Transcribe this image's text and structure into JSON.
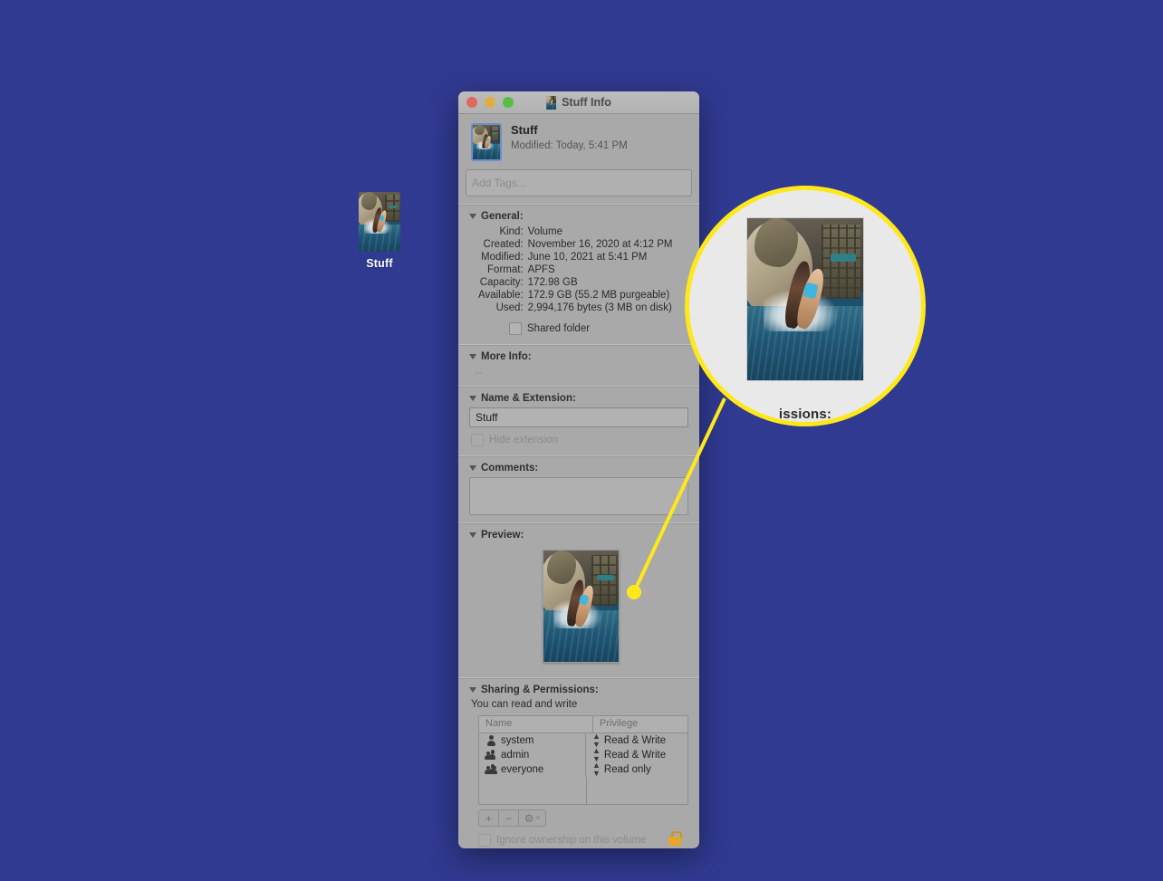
{
  "desktop": {
    "background_color": "#303a91",
    "icon": {
      "label": "Stuff",
      "name": "volume-icon"
    }
  },
  "window": {
    "title": "Stuff Info",
    "traffic_lights": {
      "close": "close-button",
      "minimize": "minimize-button",
      "zoom": "zoom-button",
      "red": "#e0695f",
      "yellow": "#dfae42",
      "green": "#57bd46"
    },
    "header": {
      "name": "Stuff",
      "modified": "Modified: Today, 5:41 PM"
    },
    "tags": {
      "placeholder": "Add Tags..."
    },
    "general": {
      "title": "General:",
      "rows": [
        {
          "key": "Kind:",
          "value": "Volume"
        },
        {
          "key": "Created:",
          "value": "November 16, 2020 at 4:12 PM"
        },
        {
          "key": "Modified:",
          "value": "June 10, 2021 at 5:41 PM"
        },
        {
          "key": "Format:",
          "value": "APFS"
        },
        {
          "key": "Capacity:",
          "value": "172.98 GB"
        },
        {
          "key": "Available:",
          "value": "172.9 GB (55.2 MB purgeable)"
        },
        {
          "key": "Used:",
          "value": "2,994,176 bytes (3 MB on disk)"
        }
      ],
      "shared_folder_label": "Shared folder",
      "shared_folder_checked": false
    },
    "more_info": {
      "title": "More Info:",
      "body": "--"
    },
    "name_extension": {
      "title": "Name & Extension:",
      "value": "Stuff",
      "hide_extension_label": "Hide extension",
      "hide_extension_checked": false
    },
    "comments": {
      "title": "Comments:",
      "value": ""
    },
    "preview": {
      "title": "Preview:"
    },
    "sharing": {
      "title": "Sharing & Permissions:",
      "status": "You can read and write",
      "columns": [
        "Name",
        "Privilege"
      ],
      "rows": [
        {
          "name": "system",
          "privilege": "Read & Write",
          "icon": "user-icon"
        },
        {
          "name": "admin",
          "privilege": "Read & Write",
          "icon": "group-icon"
        },
        {
          "name": "everyone",
          "privilege": "Read only",
          "icon": "everyone-icon"
        }
      ],
      "tools": {
        "add": "+",
        "remove": "−",
        "gear": "⚙",
        "gear_chevron": "˅"
      },
      "ignore_ownership_label": "Ignore ownership on this volume",
      "ignore_ownership_checked": false,
      "lock": "lock-icon"
    }
  },
  "callout": {
    "ring_color": "#ffe81a",
    "fill_color": "#e9e9e9",
    "magnified_text": "issions:"
  }
}
